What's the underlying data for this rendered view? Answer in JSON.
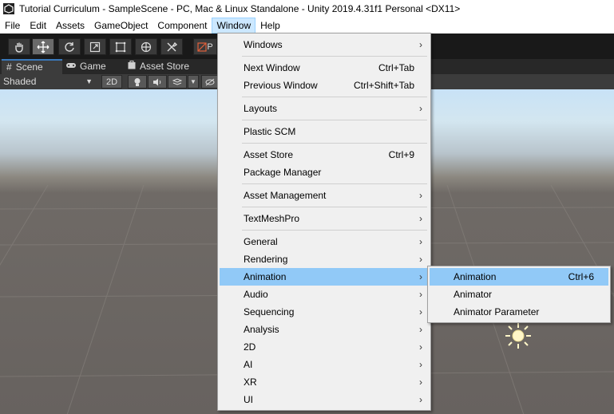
{
  "title": "Tutorial Curriculum - SampleScene - PC, Mac & Linux Standalone - Unity 2019.4.31f1 Personal <DX11>",
  "menubar": [
    "File",
    "Edit",
    "Assets",
    "GameObject",
    "Component",
    "Window",
    "Help"
  ],
  "active_menu": "Window",
  "tabs": {
    "scene": "Scene",
    "game": "Game",
    "asset_store": "Asset Store"
  },
  "scene_toolbar": {
    "shading": "Shaded",
    "two_d": "2D"
  },
  "window_menu": {
    "windows": "Windows",
    "next_window": "Next Window",
    "next_window_sc": "Ctrl+Tab",
    "prev_window": "Previous Window",
    "prev_window_sc": "Ctrl+Shift+Tab",
    "layouts": "Layouts",
    "plastic": "Plastic SCM",
    "asset_store": "Asset Store",
    "asset_store_sc": "Ctrl+9",
    "package_manager": "Package Manager",
    "asset_management": "Asset Management",
    "textmeshpro": "TextMeshPro",
    "general": "General",
    "rendering": "Rendering",
    "animation": "Animation",
    "audio": "Audio",
    "sequencing": "Sequencing",
    "analysis": "Analysis",
    "twod": "2D",
    "ai": "AI",
    "xr": "XR",
    "ui": "UI"
  },
  "animation_submenu": {
    "animation": "Animation",
    "animation_sc": "Ctrl+6",
    "animator": "Animator",
    "animator_parameter": "Animator Parameter"
  },
  "play_label": "P",
  "colors": {
    "highlight": "#91c9f7",
    "menu_bg": "#f0f0f0",
    "toolbar_bg": "#191919"
  }
}
